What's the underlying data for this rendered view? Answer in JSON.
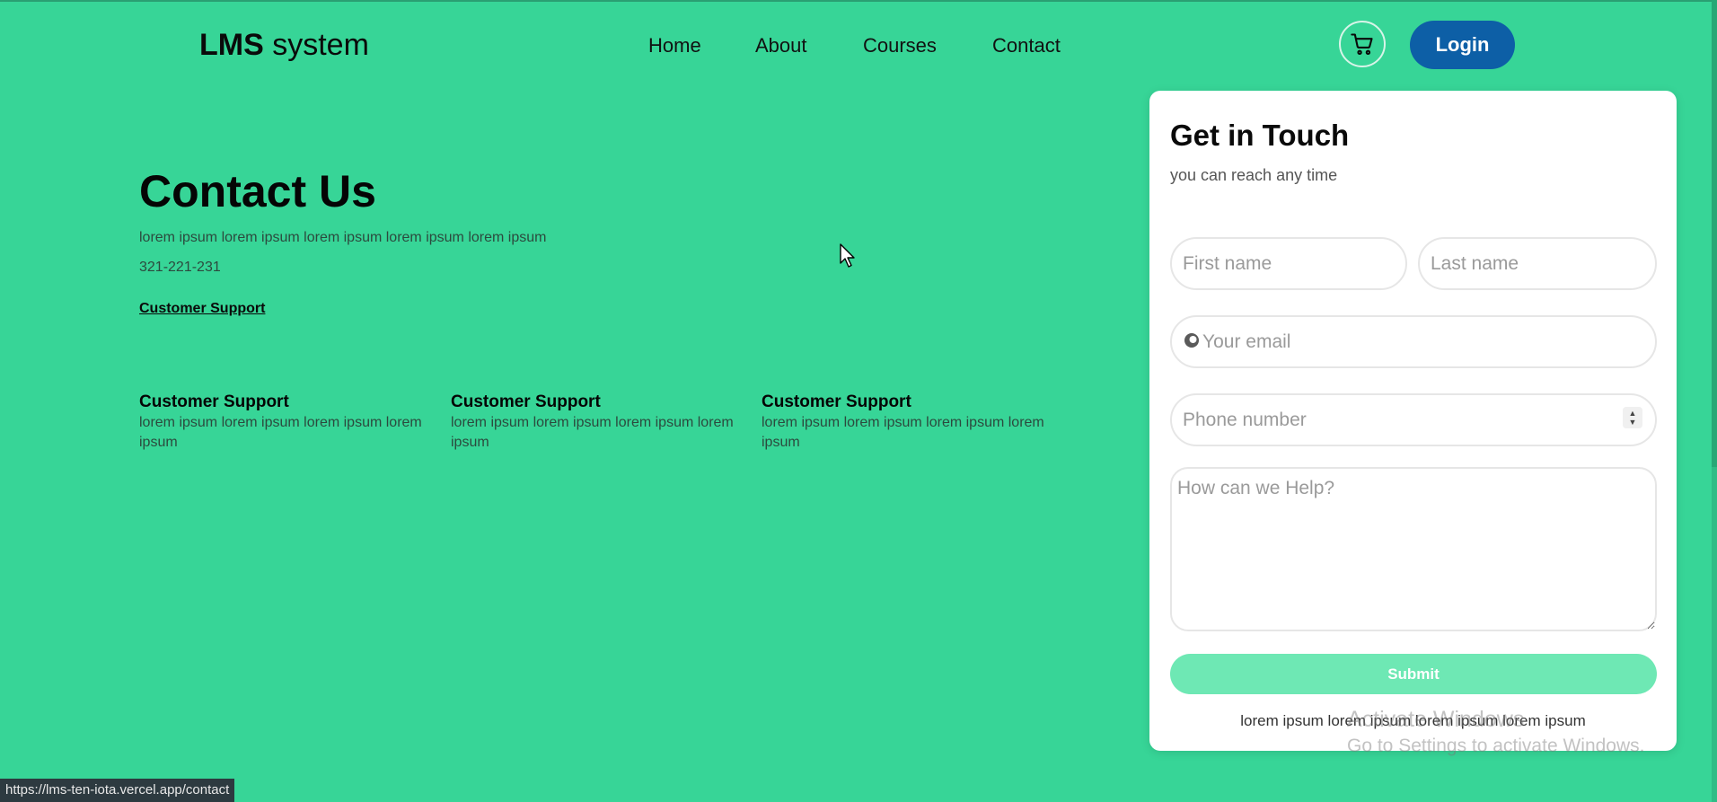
{
  "brand": {
    "bold": "LMS",
    "rest": " system"
  },
  "nav": {
    "items": [
      {
        "label": "Home"
      },
      {
        "label": "About"
      },
      {
        "label": "Courses"
      },
      {
        "label": "Contact"
      }
    ],
    "cart_icon": "shopping-cart-icon",
    "login_label": "Login"
  },
  "contact": {
    "title": "Contact Us",
    "description": "lorem ipsum lorem ipsum lorem ipsum lorem ipsum lorem ipsum",
    "phone": "321-221-231",
    "support_link": "Customer Support"
  },
  "support_columns": [
    {
      "heading": "Customer Support",
      "text": "lorem ipsum lorem ipsum lorem ipsum lorem ipsum"
    },
    {
      "heading": "Customer Support",
      "text": "lorem ipsum lorem ipsum lorem ipsum lorem ipsum"
    },
    {
      "heading": "Customer Support",
      "text": "lorem ipsum lorem ipsum lorem ipsum lorem ipsum"
    }
  ],
  "form": {
    "title": "Get in Touch",
    "subtitle": "you can reach any time",
    "first_name_placeholder": "First name",
    "last_name_placeholder": "Last name",
    "email_placeholder": "Your email",
    "phone_placeholder": "Phone number",
    "message_placeholder": "How can we Help?",
    "submit_label": "Submit",
    "footer": "lorem ipsum lorem ipsum lorem ipsum lorem ipsum"
  },
  "watermark": {
    "line1": "Activate Windows",
    "line2": "Go to Settings to activate Windows."
  },
  "status_url": "https://lms-ten-iota.vercel.app/contact",
  "colors": {
    "background": "#37d597",
    "login_button": "#0d5fa6",
    "submit_button": "#6ee8b4"
  }
}
